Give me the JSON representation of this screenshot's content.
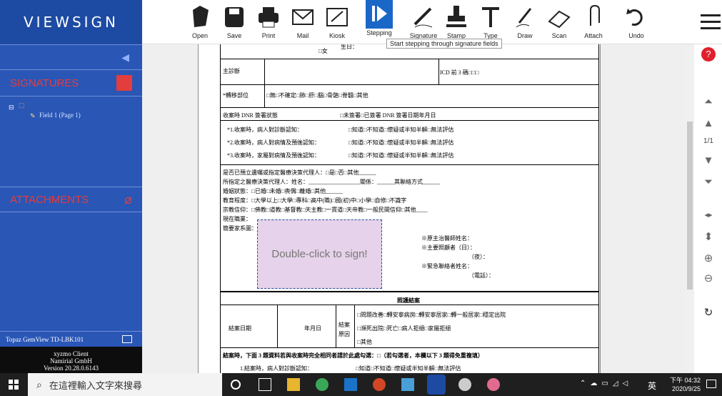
{
  "app": {
    "logo": "VIEWSIGN"
  },
  "sidebar": {
    "signatures_label": "SIGNATURES",
    "field_label": "Field 1 (Page 1)",
    "attachments_label": "ATTACHMENTS",
    "device": "Topaz GemView TD-LBK101",
    "client_line1": "xyzmo Client",
    "client_line2": "Namirial GmbH",
    "client_line3": "Version 20.28.0.6143"
  },
  "toolbar": {
    "items": [
      {
        "label": "Open",
        "icon": "folder-open-icon"
      },
      {
        "label": "Save",
        "icon": "save-icon"
      },
      {
        "label": "Print",
        "icon": "print-icon"
      },
      {
        "label": "Mail",
        "icon": "mail-icon"
      },
      {
        "label": "Kiosk",
        "icon": "kiosk-icon"
      },
      {
        "label": "Stepping",
        "icon": "stepping-icon"
      },
      {
        "label": "Signature",
        "icon": "signature-icon"
      },
      {
        "label": "Stamp",
        "icon": "stamp-icon"
      },
      {
        "label": "Type",
        "icon": "type-icon"
      },
      {
        "label": "Draw",
        "icon": "draw-icon"
      },
      {
        "label": "Scan",
        "icon": "scan-icon"
      },
      {
        "label": "Attach",
        "icon": "attach-icon"
      },
      {
        "label": "Undo",
        "icon": "undo-icon"
      }
    ],
    "tooltip": "Start stepping through signature fields"
  },
  "document": {
    "sigbox": "Double-click to sign!",
    "row_gender": "□女",
    "row_birth": "生日：",
    "row_diag": "主診斷",
    "row_icd": "ICD 前 3 碼□□□",
    "row_metastasis": "*轉移部位",
    "row_metastasis_opts": "□無□不確定□肺□肝□腦□骨骼□脊髓□其他",
    "row_dnr": "收案時 DNR 簽署狀態",
    "row_dnr_opts": "□未簽署□已簽署 DNR 簽署日期年月日",
    "q1": "*1.收案時，病人對診斷認知：",
    "q1_opts": "□知道□不知道□懷疑或半知半解□無法評估",
    "q2": "*2.收案時，病人對病情及預後認知：",
    "q2_opts": "□知道□不知道□懷疑或半知半解□無法評估",
    "q3": "*3.收案時，家屬對病情及預後認知：",
    "q3_opts": "□知道□不知道□懷疑或半知半解□無法評估",
    "p1": "是否已預立遺囑或指定醫療決策代理人：□是□否□其他______",
    "p2": "所指定之醫療決策代理人：姓名：__________________關係：______其聯絡方式______",
    "p3": "婚姻狀態：□已婚□未婚□喪偶□離婚□其他______",
    "p4": "教育程度：□大學以上□大學□專科□高中(職)□國(初)中□小學□自修□不識字",
    "p5": "宗教信仰：□佛教□道教□基督教□天主教□一貫道□天帝教□一般民間信仰□其他____",
    "p6": "現在職業：",
    "p7": "簡要家系圖：",
    "n1": "※原主治醫師姓名：",
    "n2": "※主要照顧者（日）：",
    "n3": "（夜）：",
    "n4": "※緊急聯絡者姓名：",
    "n5": "（電話）：",
    "close_title": "照護結案",
    "close_date": "結案日期",
    "close_ymd": "年月日",
    "close_reason": "結案原因",
    "c1": "□問題改善□轉安寧病房□轉安寧居家□轉一般居家□穩定出院",
    "c2": "□瀕死出院□死亡□病人拒絕□家屬拒絕",
    "c3": "□其他",
    "f1": "結案時，下面 3 題資料若與收案時完全相同者請於此處勾選：□（若勾選者，本欄以下 3 題得免重複填）",
    "f2": "1.結案時，病人對診斷認知：",
    "f2_opts": "□知道□不知道□懷疑或半知半解□無法評估"
  },
  "right": {
    "page": "1/1"
  },
  "taskbar": {
    "search": "在這裡輸入文字來搜尋",
    "ime": "英",
    "time": "下午 04:32",
    "date": "2020/9/25"
  }
}
